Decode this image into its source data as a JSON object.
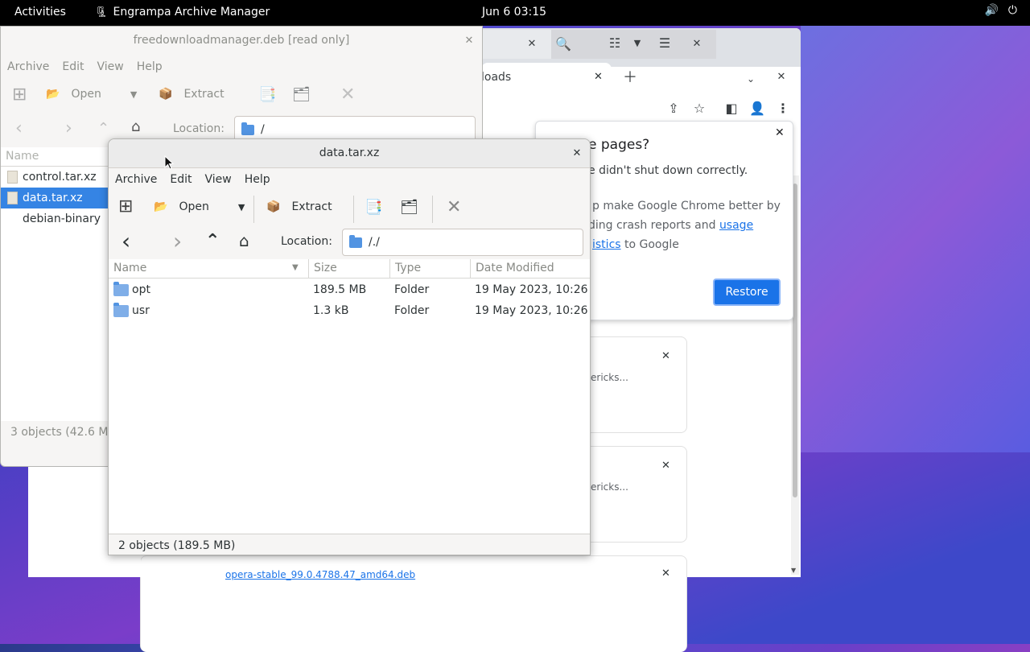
{
  "topbar": {
    "activities": "Activities",
    "app_name": "Engrampa Archive Manager",
    "clock": "Jun 6  03:15"
  },
  "chrome": {
    "tab_title": "loads",
    "restore_popup": {
      "title": "e pages?",
      "line1": "e didn't shut down correctly.",
      "help_line1": "p make Google Chrome better by",
      "help_line2_prefix": "ding crash reports and ",
      "help_link1": "usage",
      "help_link2": "istics",
      "help_line3_suffix": " to Google",
      "restore_label": "Restore"
    },
    "card_snippet": "ericks...",
    "bottom_link": "opera-stable_99.0.4788.47_amd64.deb"
  },
  "back_window": {
    "title": "freedownloadmanager.deb [read only]",
    "menu": [
      "Archive",
      "Edit",
      "View",
      "Help"
    ],
    "open_label": "Open",
    "extract_label": "Extract",
    "location_label": "Location:",
    "location_value": "/",
    "column_name": "Name",
    "files": [
      "control.tar.xz",
      "data.tar.xz",
      "debian-binary"
    ],
    "status": "3 objects (42.6 MB"
  },
  "front_window": {
    "title": "data.tar.xz",
    "menu": [
      "Archive",
      "Edit",
      "View",
      "Help"
    ],
    "open_label": "Open",
    "extract_label": "Extract",
    "location_label": "Location:",
    "location_value": "/./",
    "columns": [
      "Name",
      "Size",
      "Type",
      "Date Modified"
    ],
    "rows": [
      {
        "name": "opt",
        "size": "189.5 MB",
        "type": "Folder",
        "modified": "19 May 2023, 10:26"
      },
      {
        "name": "usr",
        "size": "1.3 kB",
        "type": "Folder",
        "modified": "19 May 2023, 10:26"
      }
    ],
    "status": "2 objects (189.5 MB)"
  }
}
